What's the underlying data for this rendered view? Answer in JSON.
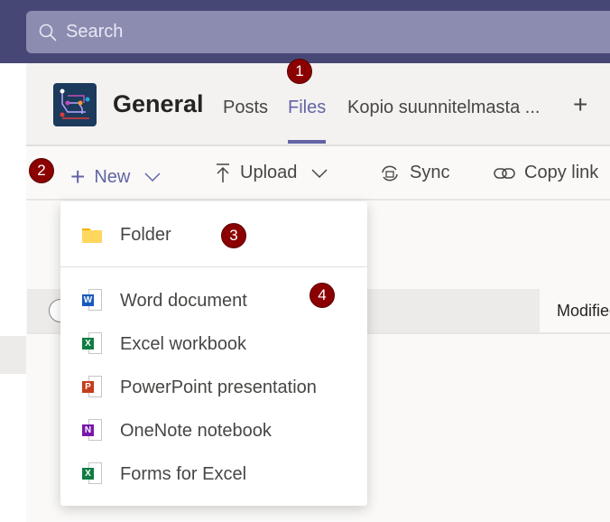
{
  "search": {
    "placeholder": "Search"
  },
  "channel": {
    "title": "General",
    "tabs": [
      {
        "label": "Posts"
      },
      {
        "label": "Files"
      },
      {
        "label": "Kopio suunnitelmasta ..."
      }
    ],
    "add_tab": "+"
  },
  "toolbar": {
    "new": "New",
    "upload": "Upload",
    "sync": "Sync",
    "copy_link": "Copy link"
  },
  "list": {
    "modified_header": "Modified"
  },
  "menu": {
    "folder": "Folder",
    "items": [
      {
        "label": "Word document",
        "icon": "word-icon",
        "letter": "W",
        "color": "#185abd"
      },
      {
        "label": "Excel workbook",
        "icon": "excel-icon",
        "letter": "X",
        "color": "#107c41"
      },
      {
        "label": "PowerPoint presentation",
        "icon": "powerpoint-icon",
        "letter": "P",
        "color": "#c43e1c"
      },
      {
        "label": "OneNote notebook",
        "icon": "onenote-icon",
        "letter": "N",
        "color": "#7719aa"
      },
      {
        "label": "Forms for Excel",
        "icon": "forms-excel-icon",
        "letter": "X",
        "color": "#107c41"
      }
    ]
  },
  "badges": [
    "1",
    "2",
    "3",
    "4"
  ],
  "colors": {
    "accent": "#6264a7",
    "topbar": "#464775",
    "badge": "#8b0000"
  }
}
